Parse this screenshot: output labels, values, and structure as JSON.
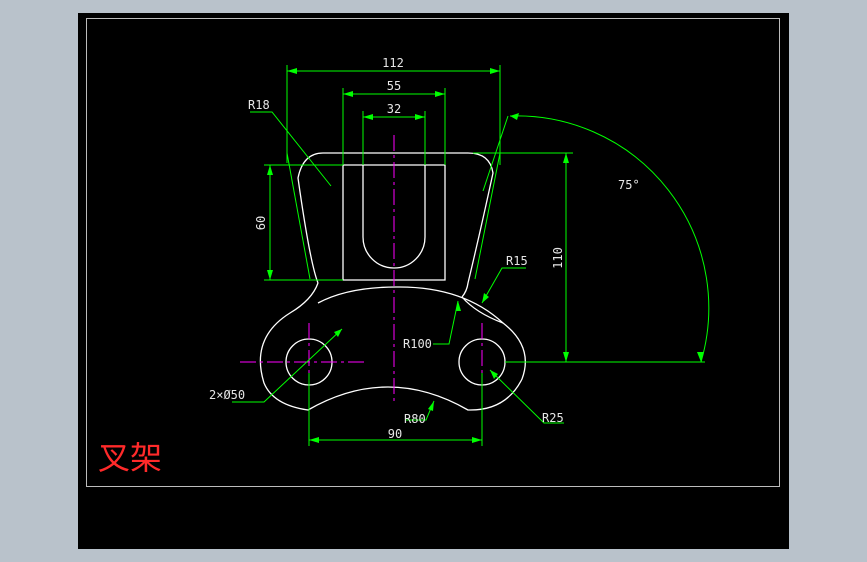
{
  "title": "叉架",
  "dimensions": {
    "overall_top_width": "112",
    "slot_block_width": "55",
    "slot_width": "32",
    "top_radius": "R18",
    "block_height": "60",
    "total_height": "110",
    "angle": "75°",
    "neck_radius": "R15",
    "base_large_radius": "R100",
    "holes": "2×Ø50",
    "base_lower_radius": "R80",
    "hole_spacing": "90",
    "end_radius": "R25"
  },
  "colors": {
    "background": "#000000",
    "outline": "#ffffff",
    "dimension": "#00ff00",
    "centerline": "#ff00ff",
    "title": "#ff2a2a",
    "frame": "#bcbcbc",
    "window": "#b9c2cb"
  }
}
